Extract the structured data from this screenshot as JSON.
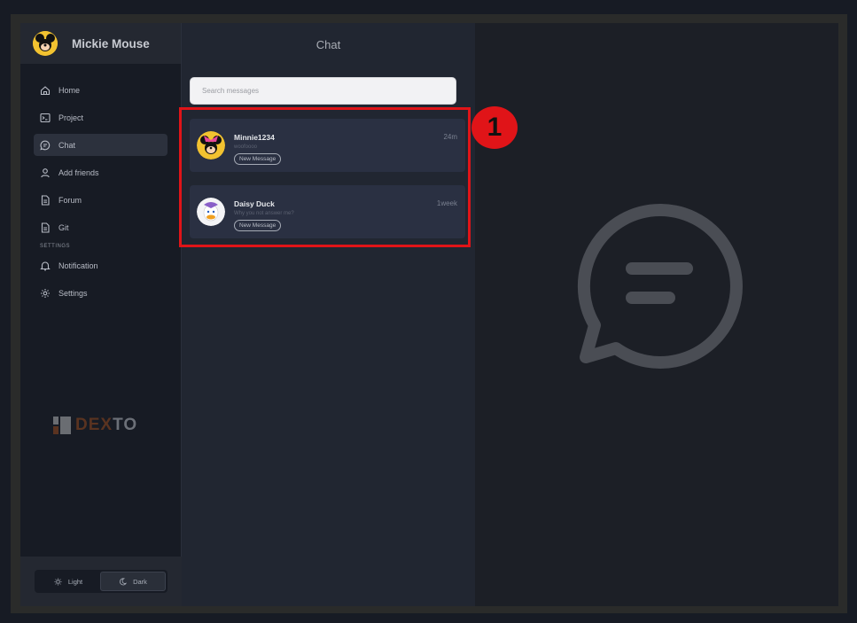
{
  "profile": {
    "name": "Mickie Mouse"
  },
  "nav": {
    "items": [
      {
        "label": "Home",
        "icon": "home-icon"
      },
      {
        "label": "Project",
        "icon": "terminal-icon"
      },
      {
        "label": "Chat",
        "icon": "chat-icon",
        "active": true
      },
      {
        "label": "Add friends",
        "icon": "user-icon"
      },
      {
        "label": "Forum",
        "icon": "document-icon"
      },
      {
        "label": "Git",
        "icon": "document-icon"
      }
    ],
    "settings_label": "SETTINGS",
    "settings_items": [
      {
        "label": "Notification",
        "icon": "bell-icon"
      },
      {
        "label": "Settings",
        "icon": "gear-icon"
      }
    ]
  },
  "brand": {
    "part1": "DEX",
    "part2": "TO"
  },
  "theme": {
    "light_label": "Light",
    "dark_label": "Dark",
    "selected": "Dark"
  },
  "chat": {
    "title": "Chat",
    "search_placeholder": "Search messages",
    "conversations": [
      {
        "name": "Minnie1234",
        "time": "24m",
        "preview": "woofoooo",
        "badge": "New Message"
      },
      {
        "name": "Daisy Duck",
        "time": "1week",
        "preview": "Why you not answer me?",
        "badge": "New Message"
      }
    ]
  },
  "annotation": {
    "step": "1"
  },
  "colors": {
    "highlight": "#e01418",
    "sidebar_bg": "#171b24",
    "list_bg": "#212631",
    "card_bg": "#2a3042"
  }
}
